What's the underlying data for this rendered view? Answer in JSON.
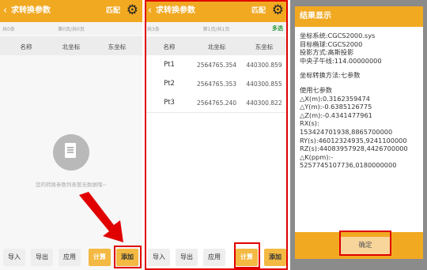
{
  "header": {
    "back": "‹",
    "title": "求转换参数",
    "match": "匹配",
    "gear": "⚙"
  },
  "panel1": {
    "count": "共0条",
    "page": "第0页/共0页",
    "empty_text": "您的转换参数列表暂无数据哦~"
  },
  "panel2": {
    "count": "共3条",
    "page": "第1页/共1页",
    "select": "多选"
  },
  "table": {
    "columns": [
      "名称",
      "北坐标",
      "东坐标"
    ],
    "rows": [
      {
        "name": "Pt1",
        "north": "2564765.354",
        "east": "440300.859"
      },
      {
        "name": "Pt2",
        "north": "2564765.353",
        "east": "440300.855"
      },
      {
        "name": "Pt3",
        "north": "2564765.240",
        "east": "440300.822"
      }
    ]
  },
  "buttons": {
    "import": "导入",
    "export": "导出",
    "apply": "应用",
    "calc": "计算",
    "add": "添加"
  },
  "dialog": {
    "title": "结果显示",
    "lines1": [
      "坐标系统:CGCS2000.sys",
      "目标椭球:CGCS2000",
      "投影方式:高斯投影",
      "中央子午线:114.00000000"
    ],
    "method": "坐标转换方法:七参数",
    "lines2": [
      "使用七参数",
      "△X(m):0.3162359474",
      "△Y(m):-0.6385126775",
      "△Z(m):-0.4341477961",
      "RX(s):",
      "153424701938,8865700000",
      "RY(s):46012324935,9241100000",
      "RZ(s):44083957928,4426700000",
      "△K(ppm):-",
      "5257745107736,0180000000"
    ],
    "ok": "确定"
  },
  "colors": {
    "accent": "#f1a922",
    "highlight": "#e00000",
    "select_green": "#2e9c3e"
  }
}
